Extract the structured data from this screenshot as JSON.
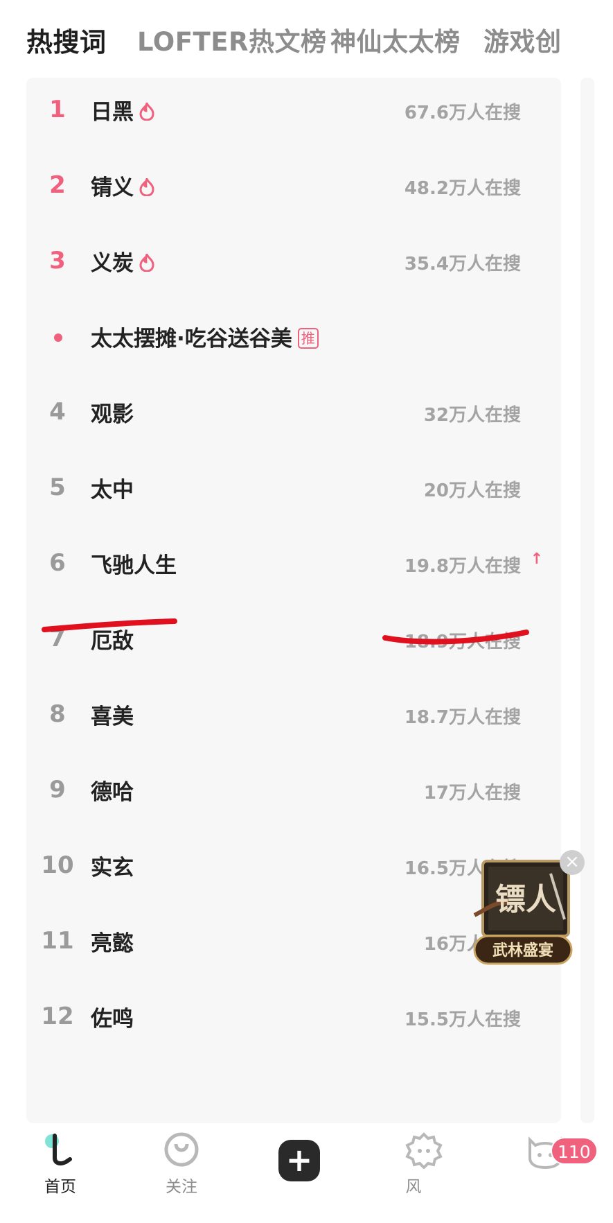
{
  "tabs": [
    {
      "label": "热搜词",
      "active": true
    },
    {
      "label": "LOFTER热文榜",
      "active": false
    },
    {
      "label": "神仙太太榜",
      "active": false
    },
    {
      "label": "游戏创",
      "active": false
    }
  ],
  "hot_list": [
    {
      "rank": "1",
      "word": "日黑",
      "count": "67.6万人在搜",
      "hot": true
    },
    {
      "rank": "2",
      "word": "锖义",
      "count": "48.2万人在搜",
      "hot": true
    },
    {
      "rank": "3",
      "word": "义炭",
      "count": "35.4万人在搜",
      "hot": true
    },
    {
      "rank": "",
      "word": "太太摆摊·吃谷送谷美",
      "tag": "推",
      "promoted": true
    },
    {
      "rank": "4",
      "word": "观影",
      "count": "32万人在搜"
    },
    {
      "rank": "5",
      "word": "太中",
      "count": "20万人在搜"
    },
    {
      "rank": "6",
      "word": "飞驰人生",
      "count": "19.8万人在搜",
      "trend": "up"
    },
    {
      "rank": "7",
      "word": "厄敌",
      "count": "18.9万人在搜"
    },
    {
      "rank": "8",
      "word": "喜美",
      "count": "18.7万人在搜"
    },
    {
      "rank": "9",
      "word": "德哈",
      "count": "17万人在搜"
    },
    {
      "rank": "10",
      "word": "实玄",
      "count": "16.5万人在搜"
    },
    {
      "rank": "11",
      "word": "亮懿",
      "count": "16万人在搜"
    },
    {
      "rank": "12",
      "word": "佐鸣",
      "count": "15.5万人在搜"
    }
  ],
  "trend_up_glyph": "↑",
  "float_ad": {
    "title": "镖人",
    "subtitle": "武林盛宴",
    "close_glyph": "×"
  },
  "bottom_nav": {
    "home_label": "首页",
    "follow_label": "关注",
    "plus_glyph": "+",
    "explore_label": "风",
    "badge": "110"
  },
  "colors": {
    "accent": "#f0617d",
    "annotation": "#e0101e",
    "panel_bg": "#f7f7f8"
  }
}
